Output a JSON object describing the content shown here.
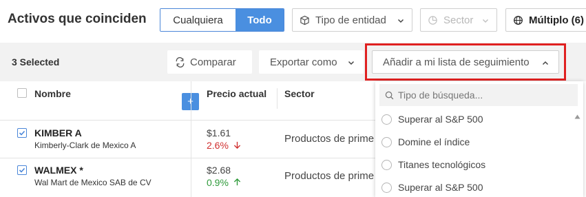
{
  "header": {
    "title": "Activos que coinciden",
    "seg_any": "Cualquiera",
    "seg_all": "Todo",
    "entity_label": "Tipo de entidad",
    "sector_label": "Sector",
    "multiple_label": "Múltiplo (6)"
  },
  "toolbar": {
    "selected": "3 Selected",
    "compare": "Comparar",
    "export": "Exportar como",
    "watchlist": "Añadir a mi lista de seguimiento"
  },
  "table": {
    "col_name": "Nombre",
    "col_price": "Precio actual",
    "col_sector": "Sector",
    "plus": "+",
    "rows": [
      {
        "ticker": "KIMBER A",
        "company": "Kimberly-Clark de Mexico A",
        "price": "$1.61",
        "change": "2.6%",
        "direction": "down",
        "sector": "Productos de prime"
      },
      {
        "ticker": "WALMEX *",
        "company": "Wal Mart de Mexico SAB de CV",
        "price": "$2.68",
        "change": "0.9%",
        "direction": "up",
        "sector": "Productos de prime"
      }
    ]
  },
  "watchlist_dropdown": {
    "search_placeholder": "Tipo de búsqueda...",
    "options": [
      "Superar al S&P 500",
      "Domine el índice",
      "Titanes tecnológicos",
      "Superar al S&P 500"
    ]
  },
  "colors": {
    "accent": "#4a8fe0",
    "highlight": "#e02020",
    "down": "#d03030",
    "up": "#2e9a3a"
  },
  "icons": [
    "cube-icon",
    "pie-icon",
    "globe-icon",
    "compare-icon",
    "chevron-down-icon",
    "chevron-up-icon",
    "search-icon",
    "check-icon",
    "arrow-down-icon",
    "arrow-up-icon"
  ]
}
